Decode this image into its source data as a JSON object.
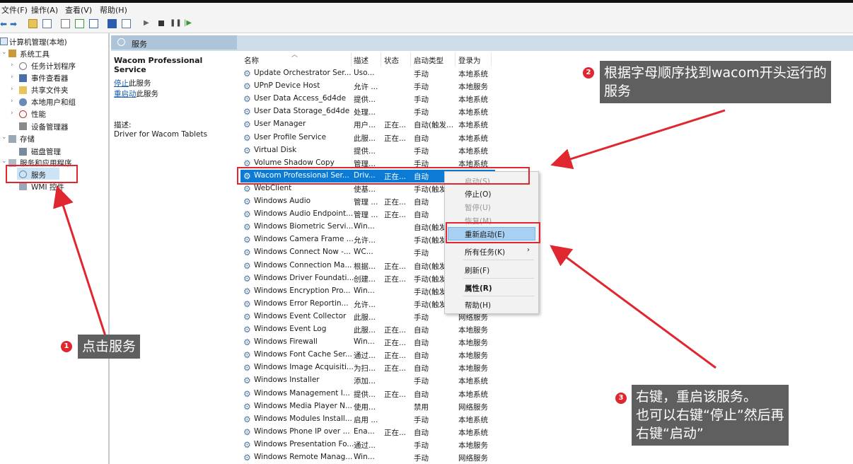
{
  "menu": {
    "file": "文件(F)",
    "action": "操作(A)",
    "view": "查看(V)",
    "help": "帮助(H)"
  },
  "tree": {
    "root": "计算机管理(本地)",
    "system_tools": "系统工具",
    "task_scheduler": "任务计划程序",
    "event_viewer": "事件查看器",
    "shared_folders": "共享文件夹",
    "local_users": "本地用户和组",
    "performance": "性能",
    "device_manager": "设备管理器",
    "storage": "存储",
    "disk_mgmt": "磁盘管理",
    "services_apps": "服务和应用程序",
    "services": "服务",
    "wmi": "WMI 控件"
  },
  "pane_header": "服务",
  "detail": {
    "service_title": "Wacom Professional Service",
    "stop_link": "停止",
    "stop_rest": "此服务",
    "restart_link": "重启动",
    "restart_rest": "此服务",
    "desc_label": "描述:",
    "desc_text": "Driver for Wacom Tablets"
  },
  "columns": {
    "name": "名称",
    "desc": "描述",
    "status": "状态",
    "startup": "启动类型",
    "logon": "登录为"
  },
  "services": [
    {
      "name": "Update Orchestrator Ser...",
      "desc": "Uso...",
      "status": "",
      "startup": "手动",
      "logon": "本地系统"
    },
    {
      "name": "UPnP Device Host",
      "desc": "允许 ...",
      "status": "",
      "startup": "手动",
      "logon": "本地服务"
    },
    {
      "name": "User Data Access_6d4de",
      "desc": "提供...",
      "status": "",
      "startup": "手动",
      "logon": "本地系统"
    },
    {
      "name": "User Data Storage_6d4de",
      "desc": "处理...",
      "status": "",
      "startup": "手动",
      "logon": "本地系统"
    },
    {
      "name": "User Manager",
      "desc": "用户...",
      "status": "正在...",
      "startup": "自动(触发...",
      "logon": "本地系统"
    },
    {
      "name": "User Profile Service",
      "desc": "此服...",
      "status": "正在...",
      "startup": "自动",
      "logon": "本地系统"
    },
    {
      "name": "Virtual Disk",
      "desc": "提供...",
      "status": "",
      "startup": "手动",
      "logon": "本地系统"
    },
    {
      "name": "Volume Shadow Copy",
      "desc": "管理...",
      "status": "",
      "startup": "手动",
      "logon": "本地系统"
    },
    {
      "name": "Wacom Professional Ser...",
      "desc": "Driv...",
      "status": "正在...",
      "startup": "自动",
      "logon": ""
    },
    {
      "name": "WebClient",
      "desc": "使基...",
      "status": "",
      "startup": "手动(触发",
      "logon": ""
    },
    {
      "name": "Windows Audio",
      "desc": "管理 ...",
      "status": "正在...",
      "startup": "自动",
      "logon": ""
    },
    {
      "name": "Windows Audio Endpoint...",
      "desc": "管理 ...",
      "status": "正在...",
      "startup": "自动",
      "logon": ""
    },
    {
      "name": "Windows Biometric Servi...",
      "desc": "Win...",
      "status": "",
      "startup": "自动(触发",
      "logon": ""
    },
    {
      "name": "Windows Camera Frame ...",
      "desc": "允许...",
      "status": "",
      "startup": "手动(触发",
      "logon": ""
    },
    {
      "name": "Windows Connect Now -...",
      "desc": "WC...",
      "status": "",
      "startup": "手动",
      "logon": ""
    },
    {
      "name": "Windows Connection Ma...",
      "desc": "根据...",
      "status": "正在...",
      "startup": "自动(触发",
      "logon": ""
    },
    {
      "name": "Windows Driver Foundati...",
      "desc": "创建...",
      "status": "正在...",
      "startup": "手动(触发",
      "logon": ""
    },
    {
      "name": "Windows Encryption Pro...",
      "desc": "Win...",
      "status": "",
      "startup": "手动(触发",
      "logon": ""
    },
    {
      "name": "Windows Error Reportin...",
      "desc": "允许...",
      "status": "",
      "startup": "手动(触发",
      "logon": ""
    },
    {
      "name": "Windows Event Collector",
      "desc": "此服...",
      "status": "",
      "startup": "手动",
      "logon": "网络服务"
    },
    {
      "name": "Windows Event Log",
      "desc": "此服...",
      "status": "正在...",
      "startup": "自动",
      "logon": "本地服务"
    },
    {
      "name": "Windows Firewall",
      "desc": "Win...",
      "status": "正在...",
      "startup": "自动",
      "logon": "本地服务"
    },
    {
      "name": "Windows Font Cache Ser...",
      "desc": "通过...",
      "status": "正在...",
      "startup": "自动",
      "logon": "本地服务"
    },
    {
      "name": "Windows Image Acquisiti...",
      "desc": "为扫...",
      "status": "正在...",
      "startup": "自动",
      "logon": "本地服务"
    },
    {
      "name": "Windows Installer",
      "desc": "添加...",
      "status": "",
      "startup": "手动",
      "logon": "本地系统"
    },
    {
      "name": "Windows Management I...",
      "desc": "提供...",
      "status": "正在...",
      "startup": "自动",
      "logon": "本地系统"
    },
    {
      "name": "Windows Media Player N...",
      "desc": "使用...",
      "status": "",
      "startup": "禁用",
      "logon": "网络服务"
    },
    {
      "name": "Windows Modules Install...",
      "desc": "启用 ...",
      "status": "",
      "startup": "手动",
      "logon": "本地系统"
    },
    {
      "name": "Windows Phone IP over ...",
      "desc": "Ena...",
      "status": "正在...",
      "startup": "自动",
      "logon": "本地系统"
    },
    {
      "name": "Windows Presentation Fo...",
      "desc": "通过...",
      "status": "",
      "startup": "手动",
      "logon": "本地服务"
    },
    {
      "name": "Windows Remote Manag...",
      "desc": "Win...",
      "status": "",
      "startup": "手动",
      "logon": "网络服务"
    }
  ],
  "context_menu": {
    "start": "启动(S)",
    "stop": "停止(O)",
    "pause": "暂停(U)",
    "resume": "恢复(M)",
    "restart": "重新启动(E)",
    "all_tasks": "所有任务(K)",
    "refresh": "刷新(F)",
    "properties": "属性(R)",
    "help": "帮助(H)"
  },
  "annotations": {
    "badge1": "1",
    "text1": "点击服务",
    "badge2": "2",
    "text2_line1": "根据字母顺序找到wacom开头运行的",
    "text2_line2": "服务",
    "badge3": "3",
    "text3_line1": "右键，重启该服务。",
    "text3_line2": "也可以右键“停止”然后再",
    "text3_line3": "右键“启动”"
  },
  "colors": {
    "selection": "#0b7bd5",
    "annotation_red": "#e0262e",
    "callout_bg": "#5f5f5f",
    "header_blue": "#cfdde8"
  }
}
